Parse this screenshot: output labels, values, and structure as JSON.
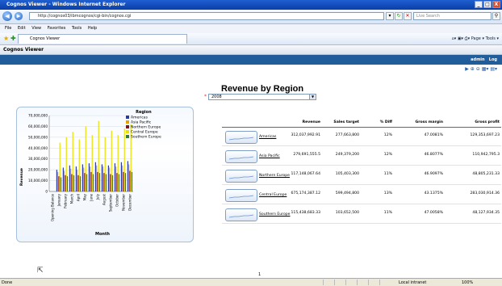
{
  "window": {
    "title": "Cognos Viewer - Windows Internet Explorer",
    "controls": [
      "_",
      "□",
      "X"
    ]
  },
  "address": {
    "url": "http://cognos03/ibmcognos/cgi-bin/cognos.cgi",
    "search_placeholder": "Live Search"
  },
  "menu": [
    "File",
    "Edit",
    "View",
    "Favorites",
    "Tools",
    "Help"
  ],
  "tab": {
    "label": "Cognos Viewer"
  },
  "cmdbar": {
    "page": "Page ▾",
    "tools": "Tools ▾"
  },
  "app": {
    "title": "Cognos Viewer",
    "user": "admin",
    "log": "Log"
  },
  "report": {
    "title": "Revenue by Region",
    "year_prompt": "2008",
    "page_number": "1"
  },
  "chart_data": {
    "type": "bar",
    "legend_title": "Region",
    "ylabel": "Revenue",
    "xlabel": "Month",
    "ylim": [
      0,
      70000000
    ],
    "yticks": [
      "70,000,000",
      "60,000,000",
      "50,000,000",
      "40,000,000",
      "30,000,000",
      "20,000,000",
      "10,000,000",
      "0"
    ],
    "categories": [
      "Opening Balance",
      "January",
      "February",
      "March",
      "April",
      "May",
      "June",
      "July",
      "August",
      "September",
      "October",
      "November",
      "December"
    ],
    "series": [
      {
        "name": "Americas",
        "color": "#2a3b9a",
        "values": [
          0,
          20000000,
          22000000,
          24000000,
          23000000,
          25000000,
          26000000,
          27000000,
          25000000,
          24000000,
          26000000,
          27000000,
          28000000
        ]
      },
      {
        "name": "Asia Pacific",
        "color": "#e8a200",
        "values": [
          0,
          18000000,
          19000000,
          21000000,
          20000000,
          22000000,
          23000000,
          24000000,
          23000000,
          22000000,
          23000000,
          24000000,
          25000000
        ]
      },
      {
        "name": "Northern Europe",
        "color": "#7a1520",
        "values": [
          0,
          14000000,
          15000000,
          16000000,
          15000000,
          17000000,
          18000000,
          18000000,
          17000000,
          16000000,
          17000000,
          18000000,
          19000000
        ]
      },
      {
        "name": "Central Europe",
        "color": "#e8e000",
        "values": [
          0,
          45000000,
          50000000,
          55000000,
          48000000,
          60000000,
          52000000,
          65000000,
          50000000,
          56000000,
          52000000,
          58000000,
          62000000
        ]
      },
      {
        "name": "Southern Europe",
        "color": "#2e7d32",
        "values": [
          0,
          13000000,
          14000000,
          15000000,
          14000000,
          16000000,
          16000000,
          17000000,
          16000000,
          15000000,
          16000000,
          17000000,
          18000000
        ]
      }
    ]
  },
  "table": {
    "headers": [
      "Revenue",
      "Sales target",
      "% Diff",
      "Gross margin",
      "Gross profit"
    ],
    "rows": [
      {
        "region": "Americas",
        "values": [
          "312,037,992.91",
          "277,663,800",
          "12%",
          "47.0081%",
          "129,353,697.23"
        ]
      },
      {
        "region": "Asia Pacific",
        "values": [
          "279,691,555.5",
          "249,379,200",
          "12%",
          "46.8077%",
          "110,942,795.3"
        ]
      },
      {
        "region": "Northern Europe",
        "values": [
          "117,148,067.64",
          "105,403,300",
          "11%",
          "46.9097%",
          "48,805,231.33"
        ]
      },
      {
        "region": "Central Europe",
        "values": [
          "675,174,387.12",
          "599,494,800",
          "13%",
          "43.1375%",
          "283,030,914.36"
        ]
      },
      {
        "region": "Southern Europe",
        "values": [
          "115,438,683.33",
          "103,652,500",
          "11%",
          "47.0058%",
          "48,127,934.35"
        ]
      }
    ]
  },
  "status": {
    "left": "Done",
    "zone": "Local intranet",
    "zoom": "100%"
  }
}
